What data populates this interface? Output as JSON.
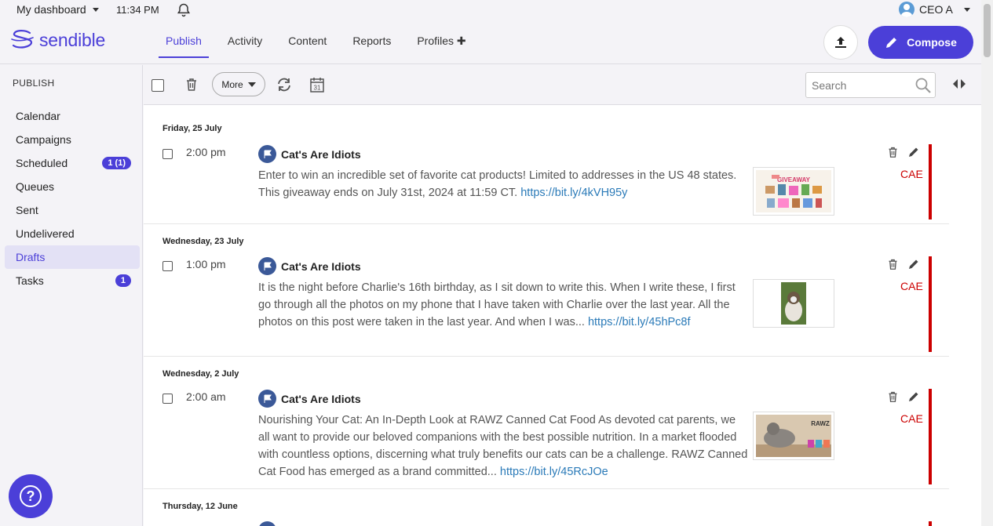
{
  "topbar": {
    "dashboard_label": "My dashboard",
    "time": "11:34 PM",
    "user_name": "CEO A"
  },
  "logo_text": "sendible",
  "nav": [
    {
      "label": "Publish",
      "active": true
    },
    {
      "label": "Activity"
    },
    {
      "label": "Content"
    },
    {
      "label": "Reports"
    },
    {
      "label": "Profiles ✚"
    }
  ],
  "compose_label": "Compose",
  "sidebar": {
    "heading": "PUBLISH",
    "items": [
      {
        "label": "Calendar"
      },
      {
        "label": "Campaigns"
      },
      {
        "label": "Scheduled",
        "badge": "1 (1)"
      },
      {
        "label": "Queues"
      },
      {
        "label": "Sent"
      },
      {
        "label": "Undelivered"
      },
      {
        "label": "Drafts",
        "active": true
      },
      {
        "label": "Tasks",
        "badge": "1"
      }
    ]
  },
  "toolbar": {
    "more_label": "More",
    "calendar_day": "31",
    "search_placeholder": "Search"
  },
  "help_glyph": "?",
  "posts": [
    {
      "date": "Friday, 25 July",
      "time": "2:00 pm",
      "profile": "Cat's Are Idiots",
      "text": "Enter to win an incredible set of favorite cat products! Limited to addresses in the US 48 states. This giveaway ends on July 31st, 2024 at 11:59 CT.",
      "link": "https://bit.ly/4kVH95y",
      "thumb_text": "GIVEAWAY",
      "tag": "CAE"
    },
    {
      "date": "Wednesday, 23 July",
      "time": "1:00 pm",
      "profile": "Cat's Are Idiots",
      "text": "It is the night before Charlie's 16th birthday, as I sit down to write this. When I write these, I first go through all the photos on my phone that I have taken with Charlie over the last year. All the photos on this post were taken in the last year. And when I was...",
      "link": "https://bit.ly/45hPc8f",
      "tag": "CAE"
    },
    {
      "date": "Wednesday, 2 July",
      "time": "2:00 am",
      "profile": "Cat's Are Idiots",
      "text": "Nourishing Your Cat: An In-Depth Look at RAWZ Canned Cat Food As devoted cat parents, we all want to provide our beloved companions with the best possible nutrition. In a market flooded with countless options, discerning what truly benefits our cats can be a challenge. RAWZ Canned Cat Food has emerged as a brand committed...",
      "link": "https://bit.ly/45RcJOe",
      "thumb_text": "RAWZ",
      "tag": "CAE"
    },
    {
      "date": "Thursday, 12 June"
    }
  ],
  "colors": {
    "accent": "#4b3fd8",
    "tag_red": "#cc0000",
    "link": "#2a7ab8"
  }
}
